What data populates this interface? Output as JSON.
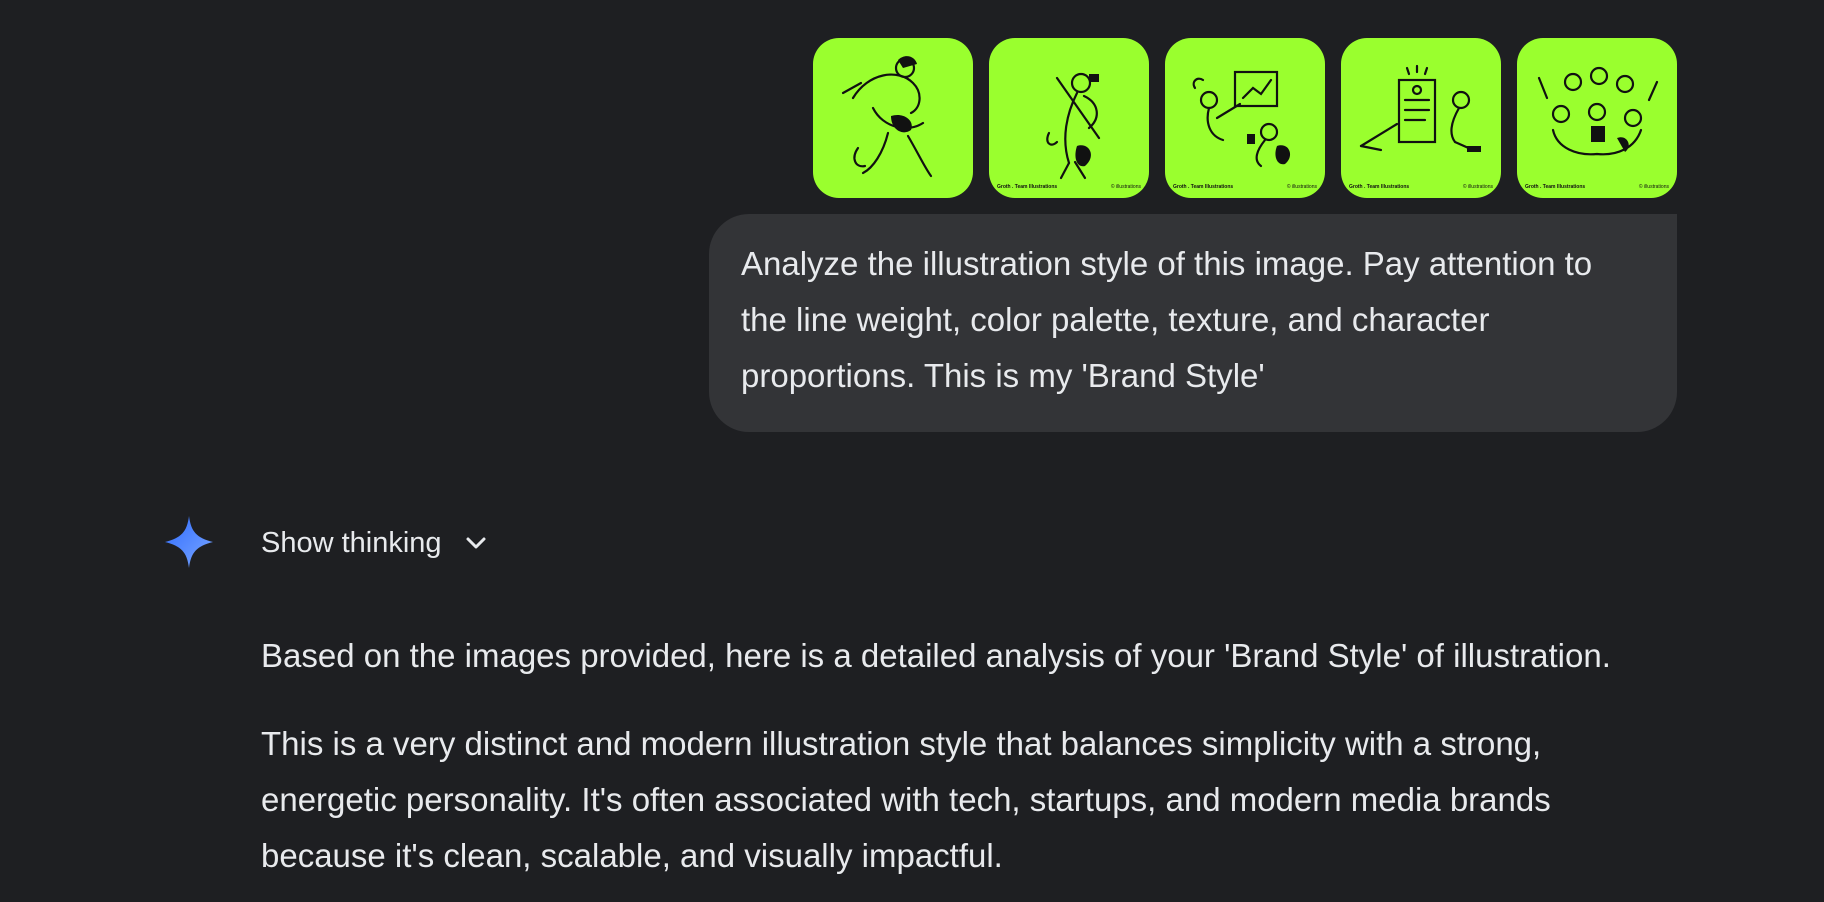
{
  "attachments": [
    {
      "name": "thumb-1",
      "caption_left": "",
      "caption_right": ""
    },
    {
      "name": "thumb-2",
      "caption_left": "Groth . Team Illustrations",
      "caption_right": "© illustrations"
    },
    {
      "name": "thumb-3",
      "caption_left": "Groth . Team Illustrations",
      "caption_right": "© illustrations"
    },
    {
      "name": "thumb-4",
      "caption_left": "Groth . Team Illustrations",
      "caption_right": "© illustrations"
    },
    {
      "name": "thumb-5",
      "caption_left": "Groth . Team Illustrations",
      "caption_right": "© illustrations"
    }
  ],
  "user_message": "Analyze the illustration style of this image. Pay attention to the line weight, color palette, texture, and character proportions. This is my 'Brand Style'",
  "assistant": {
    "icon": "gemini-spark-icon",
    "show_thinking_label": "Show thinking",
    "paragraphs": [
      "Based on the images provided, here is a detailed analysis of your 'Brand Style' of illustration.",
      "This is a very distinct and modern illustration style that balances simplicity with a strong, energetic personality. It's often associated with tech, startups, and modern media brands because it's clean, scalable, and visually impactful."
    ]
  },
  "colors": {
    "background": "#1e1f22",
    "bubble": "#333437",
    "thumb_bg": "#9aff2e",
    "text": "#e8eaed",
    "spark_blue": "#4a8cff"
  }
}
